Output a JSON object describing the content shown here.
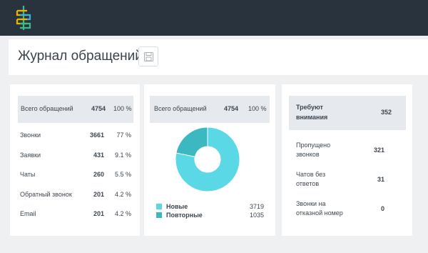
{
  "header": {
    "title": "Журнал обращений"
  },
  "summary": {
    "header": {
      "label": "Всего обращений",
      "count": "4754",
      "percent": "100 %"
    },
    "rows": [
      {
        "label": "Звонки",
        "count": "3661",
        "percent": "77 %"
      },
      {
        "label": "Заявки",
        "count": "431",
        "percent": "9.1 %"
      },
      {
        "label": "Чаты",
        "count": "260",
        "percent": "5.5 %"
      },
      {
        "label": "Обратный звонок",
        "count": "201",
        "percent": "4.2 %"
      },
      {
        "label": "Email",
        "count": "201",
        "percent": "4.2 %"
      }
    ]
  },
  "donut": {
    "header": {
      "label": "Всего обращений",
      "count": "4754",
      "percent": "100 %"
    },
    "legend": [
      {
        "label": "Новые",
        "value": "3719",
        "color": "#5ad8e6"
      },
      {
        "label": "Повторные",
        "value": "1035",
        "color": "#3bb8c0"
      }
    ]
  },
  "chart_data": {
    "type": "pie",
    "categories": [
      "Новые",
      "Повторные"
    ],
    "values": [
      3719,
      1035
    ],
    "colors": [
      "#5ad8e6",
      "#3bb8c0"
    ]
  },
  "attention": {
    "header": {
      "label_line1": "Требуют",
      "label_line2": "внимания",
      "count": "352"
    },
    "rows": [
      {
        "line1": "Пропущено",
        "line2": "звонков",
        "count": "321"
      },
      {
        "line1": "Чатов без",
        "line2": "ответов",
        "count": "31"
      },
      {
        "line1": "Звонки на",
        "line2": "отказной номер",
        "count": "0"
      }
    ]
  }
}
